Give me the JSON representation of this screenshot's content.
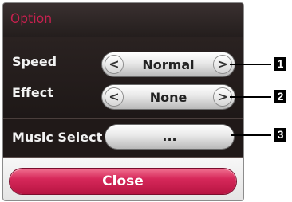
{
  "dialog": {
    "title": "Option",
    "rows": [
      {
        "label": "Speed",
        "value": "Normal",
        "prev_glyph": "<",
        "next_glyph": ">"
      },
      {
        "label": "Effect",
        "value": "None",
        "prev_glyph": "<",
        "next_glyph": ">"
      }
    ],
    "music_select": {
      "label": "Music Select",
      "value": "..."
    },
    "close_label": "Close"
  },
  "callouts": [
    "1",
    "2",
    "3"
  ],
  "colors": {
    "accent": "#c8204f",
    "dialog_bg": "#1b1514",
    "close_button": "#d6285a"
  }
}
